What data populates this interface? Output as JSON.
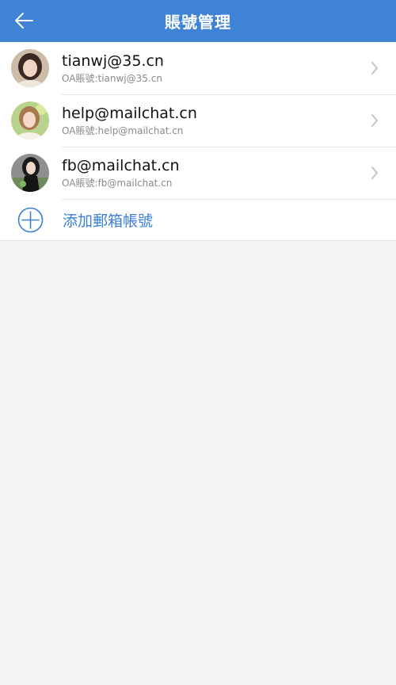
{
  "header": {
    "title": "賬號管理",
    "back_icon": "arrow-left-icon",
    "background_color": "#3f83d6"
  },
  "accounts": [
    {
      "email": "tianwj@35.cn",
      "oa_label": "OA賬號:tianwj@35.cn",
      "avatar": "avatar-woman-dark-hair"
    },
    {
      "email": "help@mailchat.cn",
      "oa_label": "OA賬號:help@mailchat.cn",
      "avatar": "avatar-woman-green-background"
    },
    {
      "email": "fb@mailchat.cn",
      "oa_label": "OA賬號:fb@mailchat.cn",
      "avatar": "avatar-woman-black-dress"
    }
  ],
  "add_account": {
    "label": "添加郵箱帳號",
    "icon": "plus-circle-icon",
    "color": "#3a7fd5"
  }
}
